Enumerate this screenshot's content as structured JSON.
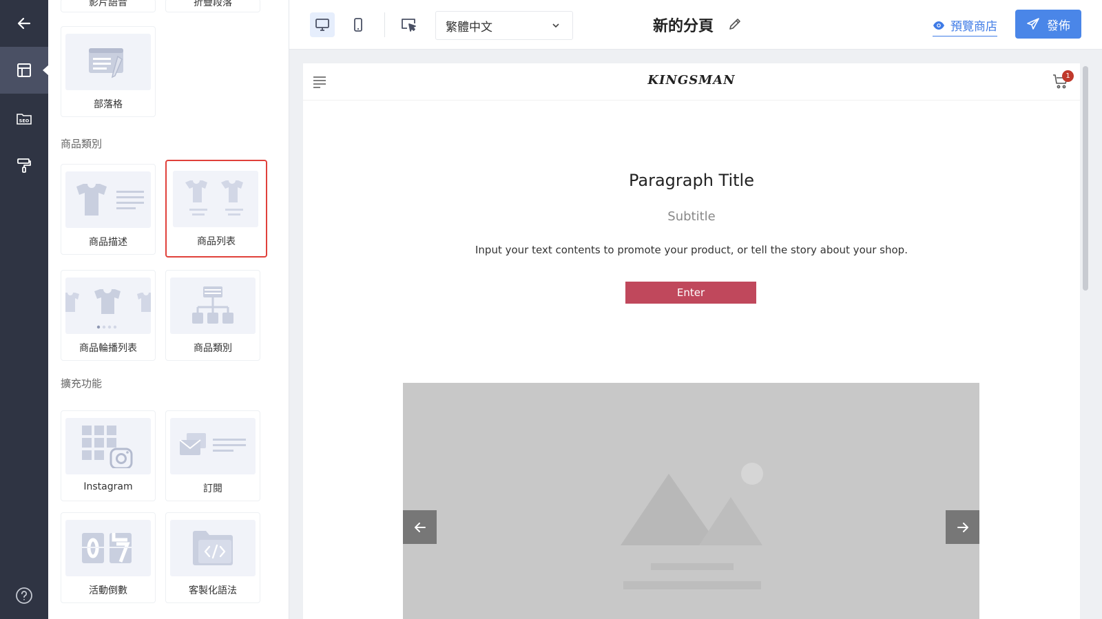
{
  "rail": {
    "items": [
      "back-arrow-icon",
      "layout-icon",
      "seo-folder-icon",
      "paint-roller-icon"
    ],
    "help_icon": "question-circle-icon",
    "seo_label": "SEO"
  },
  "panel": {
    "partial_cards": [
      "影片語音",
      "折疊段落"
    ],
    "blog_card": "部落格",
    "product_section": "商品類別",
    "product_cards": [
      "商品描述",
      "商品列表",
      "商品輪播列表",
      "商品類別"
    ],
    "extensions_section": "擴充功能",
    "extension_cards": [
      "Instagram",
      "訂閱",
      "活動倒數",
      "客製化語法"
    ]
  },
  "toolbar": {
    "language": "繁體中文",
    "page_title": "新的分頁",
    "preview_label": "預覽商店",
    "publish_label": "發佈"
  },
  "site": {
    "brand": "KINGSMAN",
    "cart_count": "1",
    "paragraph_title": "Paragraph Title",
    "subtitle": "Subtitle",
    "body": "Input your text contents to promote your product, or tell the story about your shop.",
    "button_label": "Enter"
  },
  "colors": {
    "rail_bg": "#2f3443",
    "accent": "#4a86e8",
    "enter_button": "#c0485c",
    "selected_outline": "#e0403a"
  }
}
